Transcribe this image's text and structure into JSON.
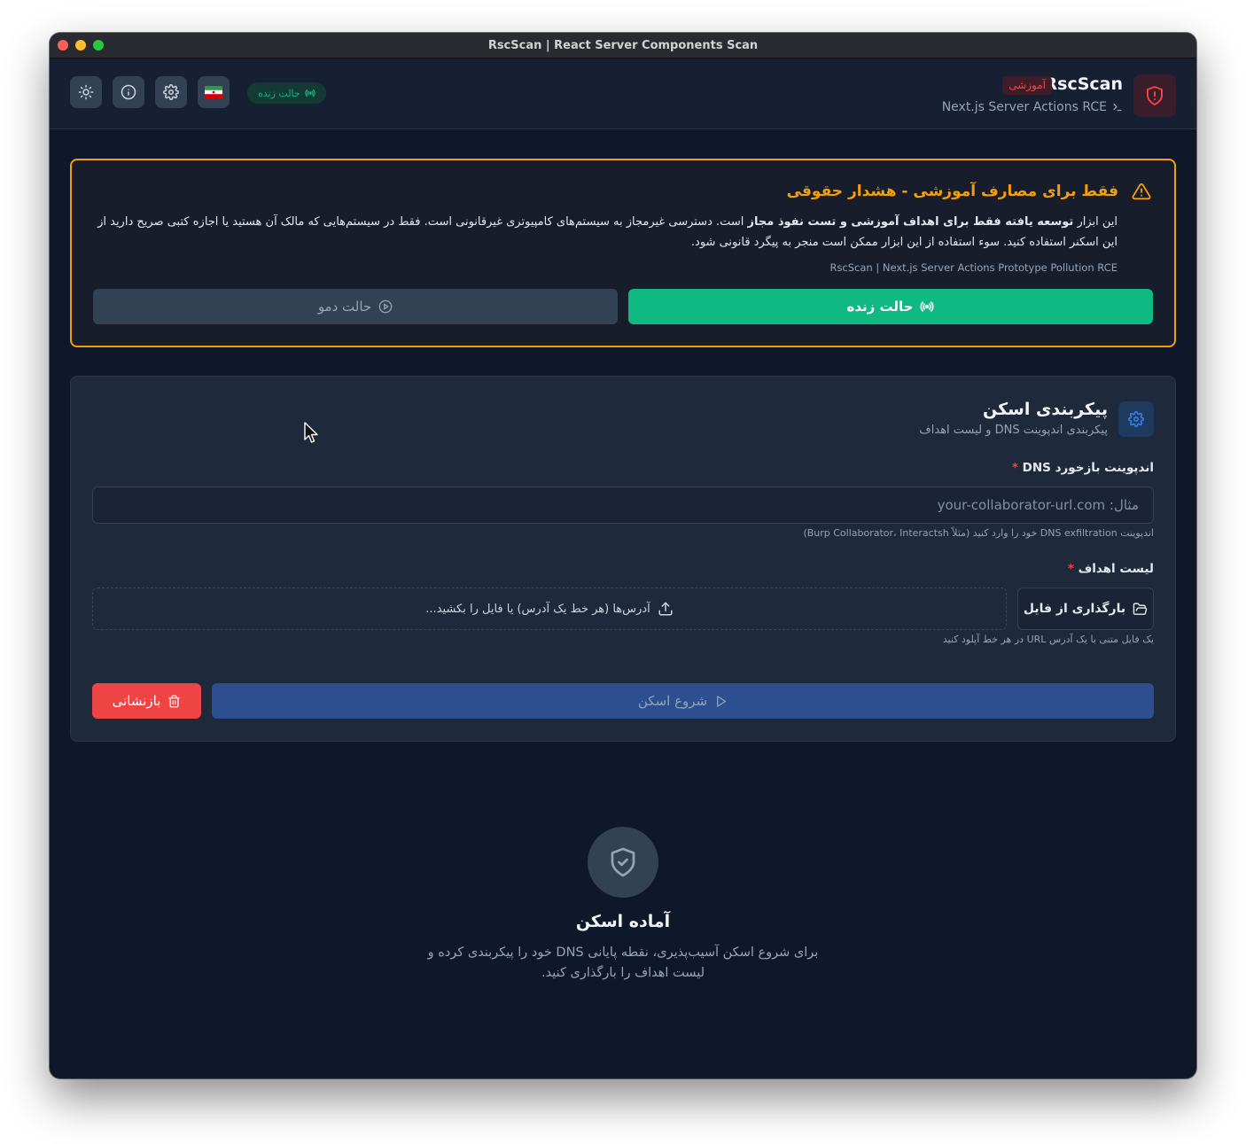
{
  "window": {
    "title": "RscScan | React Server Components Scan"
  },
  "header": {
    "brand_name": "RscScan",
    "brand_badge": "آموزشی",
    "brand_subtitle": "Next.js Server Actions RCE",
    "live_pill": "حالت زنده",
    "icons": [
      "sun-icon",
      "info-icon",
      "gear-icon",
      "iran-flag-icon"
    ]
  },
  "warning": {
    "title": "فقط برای مصارف آموزشی - هشدار حقوقی",
    "text_pre": "این ابزار ",
    "text_bold": "توسعه یافته فقط برای اهداف آموزشی و تست نفوذ مجاز",
    "text_post": " است. دسترسی غیرمجاز به سیستم‌های کامپیوتری غیرقانونی است. فقط در سیستم‌هایی که مالک آن هستید یا اجازه کتبی صریح دارید از این اسکنر استفاده کنید. سوء استفاده از این ابزار ممکن است منجر به پیگرد قانونی شود.",
    "footer": "RscScan | Next.js Server Actions Prototype Pollution RCE",
    "live_button": "حالت زنده",
    "demo_button": "حالت دمو"
  },
  "config": {
    "title": "پیکربندی اسکن",
    "subtitle": "پیکربندی اندپوینت DNS و لیست اهداف",
    "dns_label": "اندپوینت بازخورد DNS",
    "required_mark": "*",
    "dns_placeholder": "مثال: your-collaborator-url.com",
    "dns_value": "",
    "dns_hint": "اندپوینت DNS exfiltration خود را وارد کنید (مثلاً Burp Collaborator، Interactsh)",
    "targets_label": "لیست اهداف",
    "upload_button": "بارگذاری از فایل",
    "dropzone_text": "آدرس‌ها (هر خط یک آدرس) یا فایل را بکشید...",
    "targets_hint": "یک فایل متنی با یک آدرس URL در هر خط آپلود کنید",
    "start_button": "شروع اسکن",
    "reset_button": "بازنشانی"
  },
  "ready": {
    "title": "آماده اسکن",
    "text": "برای شروع اسکن آسیب‌پذیری، نقطه پایانی DNS خود را پیکربندی کرده و لیست اهداف را بارگذاری کنید."
  },
  "colors": {
    "background": "#0f172a",
    "card": "#1e293b",
    "warning": "#f59e0b",
    "live_green": "#10b981",
    "danger": "#ef4444",
    "accent_blue": "#3b82f6"
  }
}
